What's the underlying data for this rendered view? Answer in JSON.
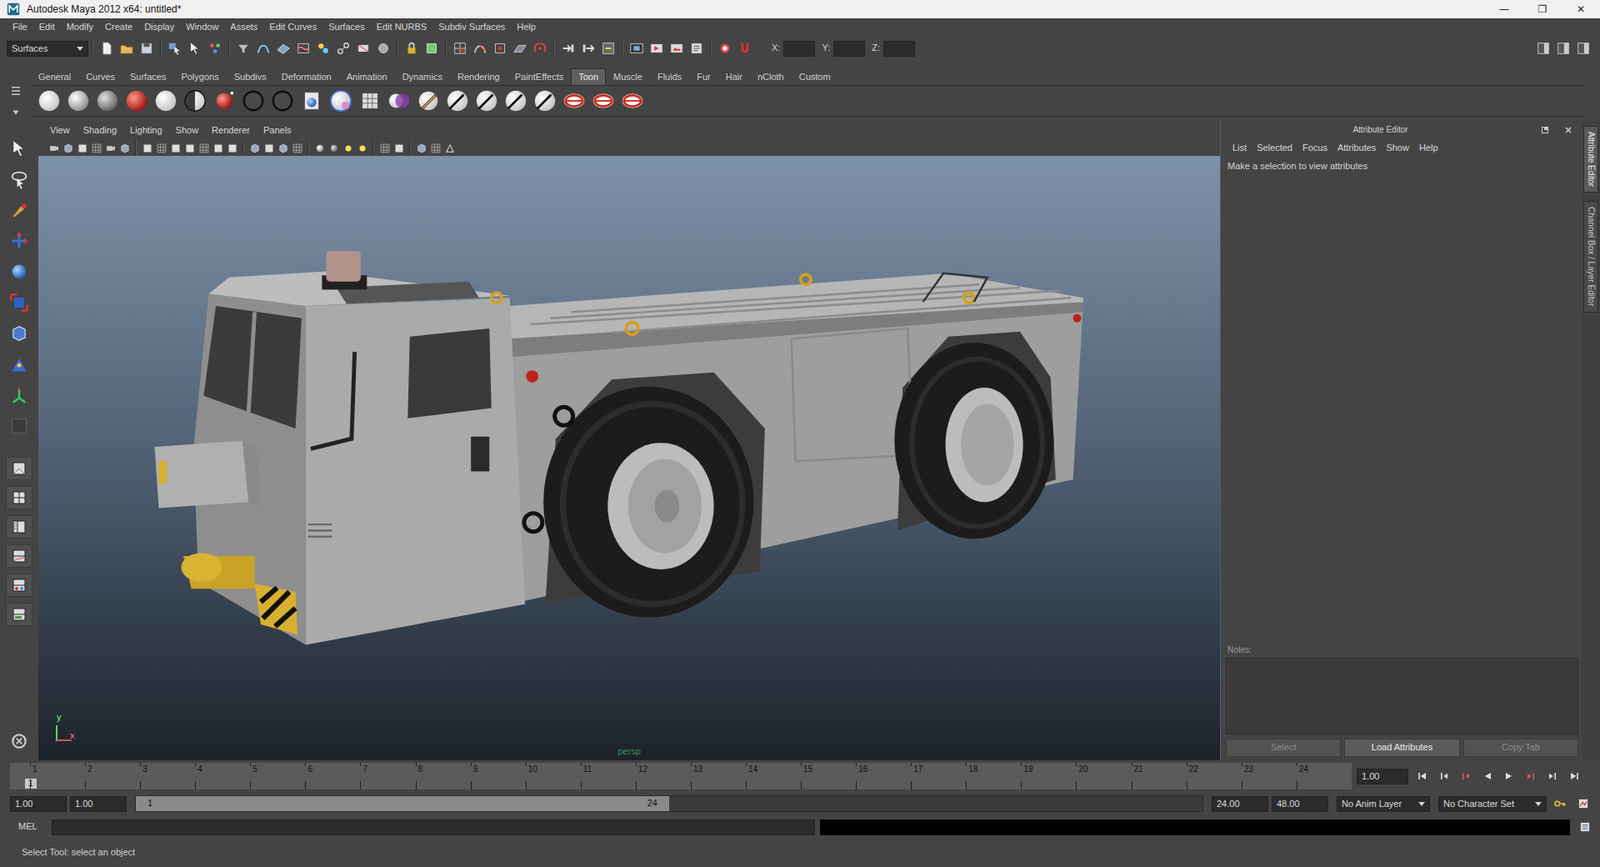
{
  "window": {
    "title": "Autodesk Maya 2012 x64: untitled*",
    "controls": [
      "—",
      "❐",
      "✕"
    ]
  },
  "menubar": [
    "File",
    "Edit",
    "Modify",
    "Create",
    "Display",
    "Window",
    "Assets",
    "Edit Curves",
    "Surfaces",
    "Edit NURBS",
    "Subdiv Surfaces",
    "Help"
  ],
  "status_line": {
    "menu_set": "Surfaces",
    "coords": [
      "X:",
      "Y:",
      "Z:"
    ]
  },
  "shelf": {
    "tabs": [
      {
        "label": "General",
        "selected": false
      },
      {
        "label": "Curves",
        "selected": false
      },
      {
        "label": "Surfaces",
        "selected": false
      },
      {
        "label": "Polygons",
        "selected": false
      },
      {
        "label": "Subdivs",
        "selected": false
      },
      {
        "label": "Deformation",
        "selected": false
      },
      {
        "label": "Animation",
        "selected": false
      },
      {
        "label": "Dynamics",
        "selected": false
      },
      {
        "label": "Rendering",
        "selected": false
      },
      {
        "label": "PaintEffects",
        "selected": false
      },
      {
        "label": "Toon",
        "selected": true
      },
      {
        "label": "Muscle",
        "selected": false
      },
      {
        "label": "Fluids",
        "selected": false
      },
      {
        "label": "Fur",
        "selected": false
      },
      {
        "label": "Hair",
        "selected": false
      },
      {
        "label": "nCloth",
        "selected": false
      },
      {
        "label": "Custom",
        "selected": false
      }
    ]
  },
  "panel": {
    "menu": [
      "View",
      "Shading",
      "Lighting",
      "Show",
      "Renderer",
      "Panels"
    ],
    "camera": "persp",
    "axis": [
      "y",
      "x"
    ]
  },
  "attribute_editor": {
    "title": "Attribute Editor",
    "menu": [
      "List",
      "Selected",
      "Focus",
      "Attributes",
      "Show",
      "Help"
    ],
    "message": "Make a selection to view attributes",
    "notes_label": "Notes:",
    "buttons": [
      {
        "label": "Select",
        "disabled": true
      },
      {
        "label": "Load Attributes",
        "disabled": false
      },
      {
        "label": "Copy Tab",
        "disabled": true
      }
    ]
  },
  "side_tabs": [
    {
      "label": "Attribute Editor",
      "selected": true
    },
    {
      "label": "Channel Box / Layer Editor",
      "selected": false
    }
  ],
  "time_slider": {
    "ticks": [
      "1",
      "2",
      "3",
      "4",
      "5",
      "6",
      "7",
      "8",
      "9",
      "10",
      "11",
      "12",
      "13",
      "14",
      "15",
      "16",
      "17",
      "18",
      "19",
      "20",
      "21",
      "22",
      "23",
      "24"
    ],
    "current_frame": "1",
    "frame_field": "1.00"
  },
  "range_slider": {
    "start": "1.00",
    "playback_start": "1.00",
    "handle_start": "1",
    "handle_end": "24",
    "playback_end": "24.00",
    "end": "48.00",
    "level": 0.5
  },
  "anim_layer": "No Anim Layer",
  "character_set": "No Character Set",
  "command_line": {
    "language": "MEL"
  },
  "help_line": "Select Tool: select an object"
}
